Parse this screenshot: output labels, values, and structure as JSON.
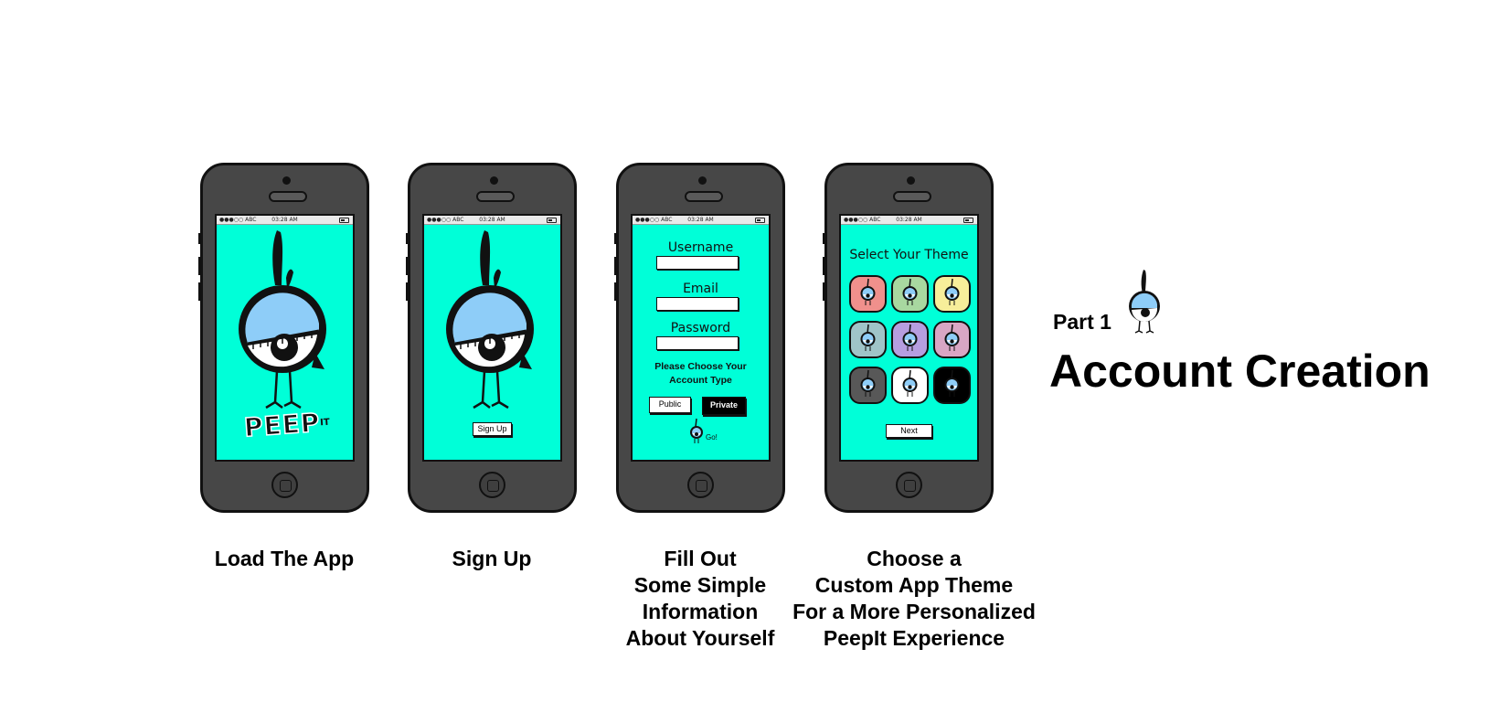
{
  "status_bar": {
    "carrier": "●●●○○ ABC",
    "time": "03:28 AM"
  },
  "phone1": {
    "logo_text": "PEEP",
    "logo_sup": "IT",
    "caption": "Load The App"
  },
  "phone2": {
    "signup_label": "Sign Up",
    "caption": "Sign Up"
  },
  "phone3": {
    "username_label": "Username",
    "email_label": "Email",
    "password_label": "Password",
    "account_type_line1": "Please Choose Your",
    "account_type_line2": "Account Type",
    "public_label": "Public",
    "private_label": "Private",
    "go_label": "Go!",
    "caption": [
      "Fill Out",
      "Some Simple",
      "Information",
      "About Yourself"
    ]
  },
  "phone4": {
    "title": "Select Your Theme",
    "next_label": "Next",
    "themes": [
      "#f0908c",
      "#a8d8a0",
      "#f7ee9a",
      "#9fc4c8",
      "#b69ee0",
      "#d8a6c4",
      "#585858",
      "#ffffff",
      "#000000"
    ],
    "caption": [
      "Choose a",
      "Custom App Theme",
      "For a More Personalized",
      "PeepIt Experience"
    ]
  },
  "heading": {
    "part": "Part 1",
    "title": "Account Creation"
  },
  "colors": {
    "screen": "#00ffd8",
    "phone_body": "#474747",
    "bird_head": "#8ecdf8"
  }
}
